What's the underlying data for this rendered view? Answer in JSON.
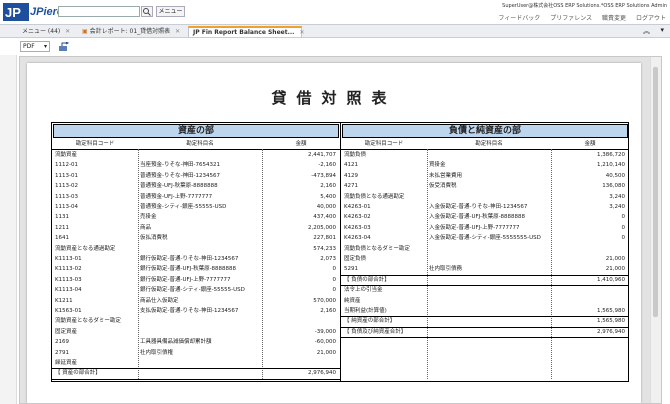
{
  "topbar": {
    "logo_text": "JPiere",
    "menu_label": "メニュー",
    "user_info": "SuperUser@株式会社OSS ERP Solutions.*OSS ERP Solutions Admin",
    "links": [
      "フィードバック",
      "プリファレンス",
      "職責変更",
      "ログアウト"
    ]
  },
  "tabs": [
    {
      "label": "メニュー (44)"
    },
    {
      "label": "会計レポート: 01_貸借対照表"
    },
    {
      "label": "JP Fin Report Balance Sheet..."
    }
  ],
  "toolbar": {
    "format_select": "PDF"
  },
  "report": {
    "title": "貸借対照表",
    "assets": {
      "header": "資産の部",
      "columns": [
        "勘定科目コード",
        "勘定科目名",
        "金額"
      ],
      "rows": [
        [
          "流動資産",
          "",
          "2,441,707"
        ],
        [
          "1112-01",
          "当座預金-りそな-神田-7654321",
          "-2,160"
        ],
        [
          "1113-01",
          "普通預金-りそな-神田-1234567",
          "-473,894"
        ],
        [
          "1113-02",
          "普通預金-UFJ-秋葉原-8888888",
          "2,160"
        ],
        [
          "1113-03",
          "普通預金-UFJ-上野-7777777",
          "5,400"
        ],
        [
          "1113-04",
          "普通預金-シティ-銀座-55555-USD",
          "40,000"
        ],
        [
          "1131",
          "売掛金",
          "437,400"
        ],
        [
          "1211",
          "商品",
          "2,205,000"
        ],
        [
          "1641",
          "仮払消費税",
          "227,801"
        ],
        [
          "流動資産となる通過勘定",
          "",
          "574,233"
        ],
        [
          "K1113-01",
          "銀行仮勘定-普通-りそな-神田-1234567",
          "2,073"
        ],
        [
          "K1113-02",
          "銀行仮勘定-普通-UFJ-秋葉原-8888888",
          "0"
        ],
        [
          "K1113-03",
          "銀行仮勘定-普通-UFJ-上野-7777777",
          "0"
        ],
        [
          "K1113-04",
          "銀行仮勘定-普通-シティ-銀座-55555-USD",
          "0"
        ],
        [
          "K1211",
          "商品仕入仮勘定",
          "570,000"
        ],
        [
          "K1563-01",
          "支払仮勘定-普通-りそな-神田-1234567",
          "2,160"
        ],
        [
          "流動資産となるダミー勘定",
          "",
          ""
        ],
        [
          "固定資産",
          "",
          "-39,000"
        ],
        [
          "2169",
          "工具器具備品減価償却累計額",
          "-60,000"
        ],
        [
          "2791",
          "社内取引債権",
          "21,000"
        ],
        [
          "繰延資産",
          "",
          ""
        ],
        [
          "【 資産の部合計】",
          "",
          "2,976,940"
        ]
      ]
    },
    "liabilities": {
      "header": "負債と純資産の部",
      "columns": [
        "勘定科目コード",
        "勘定科目名",
        "金額"
      ],
      "rows": [
        [
          "流動負債",
          "",
          "1,386,720"
        ],
        [
          "4121",
          "買掛金",
          "1,210,140"
        ],
        [
          "4129",
          "未払営業費用",
          "40,500"
        ],
        [
          "4271",
          "仮受消費税",
          "136,080"
        ],
        [
          "流動負債となる通過勘定",
          "",
          "3,240"
        ],
        [
          "K4263-01",
          "入金仮勘定-普通-りそな-神田-1234567",
          "3,240"
        ],
        [
          "K4263-02",
          "入金仮勘定-普通-UFJ-秋葉原-8888888",
          "0"
        ],
        [
          "K4263-03",
          "入金仮勘定-普通-UFJ-上野-7777777",
          "0"
        ],
        [
          "K4263-04",
          "入金仮勘定-普通-シティ-銀座-5555555-USD",
          "0"
        ],
        [
          "流動負債となるダミー勘定",
          "",
          ""
        ],
        [
          "固定負債",
          "",
          "21,000"
        ],
        [
          "5291",
          "社内取引債務",
          "21,000"
        ],
        [
          "【 負債の部合計】",
          "",
          "1,410,960"
        ],
        [
          "法令上の引当金",
          "",
          ""
        ],
        [
          "純資産",
          "",
          ""
        ],
        [
          "当期利益(計算値)",
          "",
          "1,565,980"
        ],
        [
          "【 純資産の部合計】",
          "",
          "1,565,980"
        ],
        [
          "【 負債及び純資産合計】",
          "",
          "2,976,940"
        ]
      ]
    }
  }
}
